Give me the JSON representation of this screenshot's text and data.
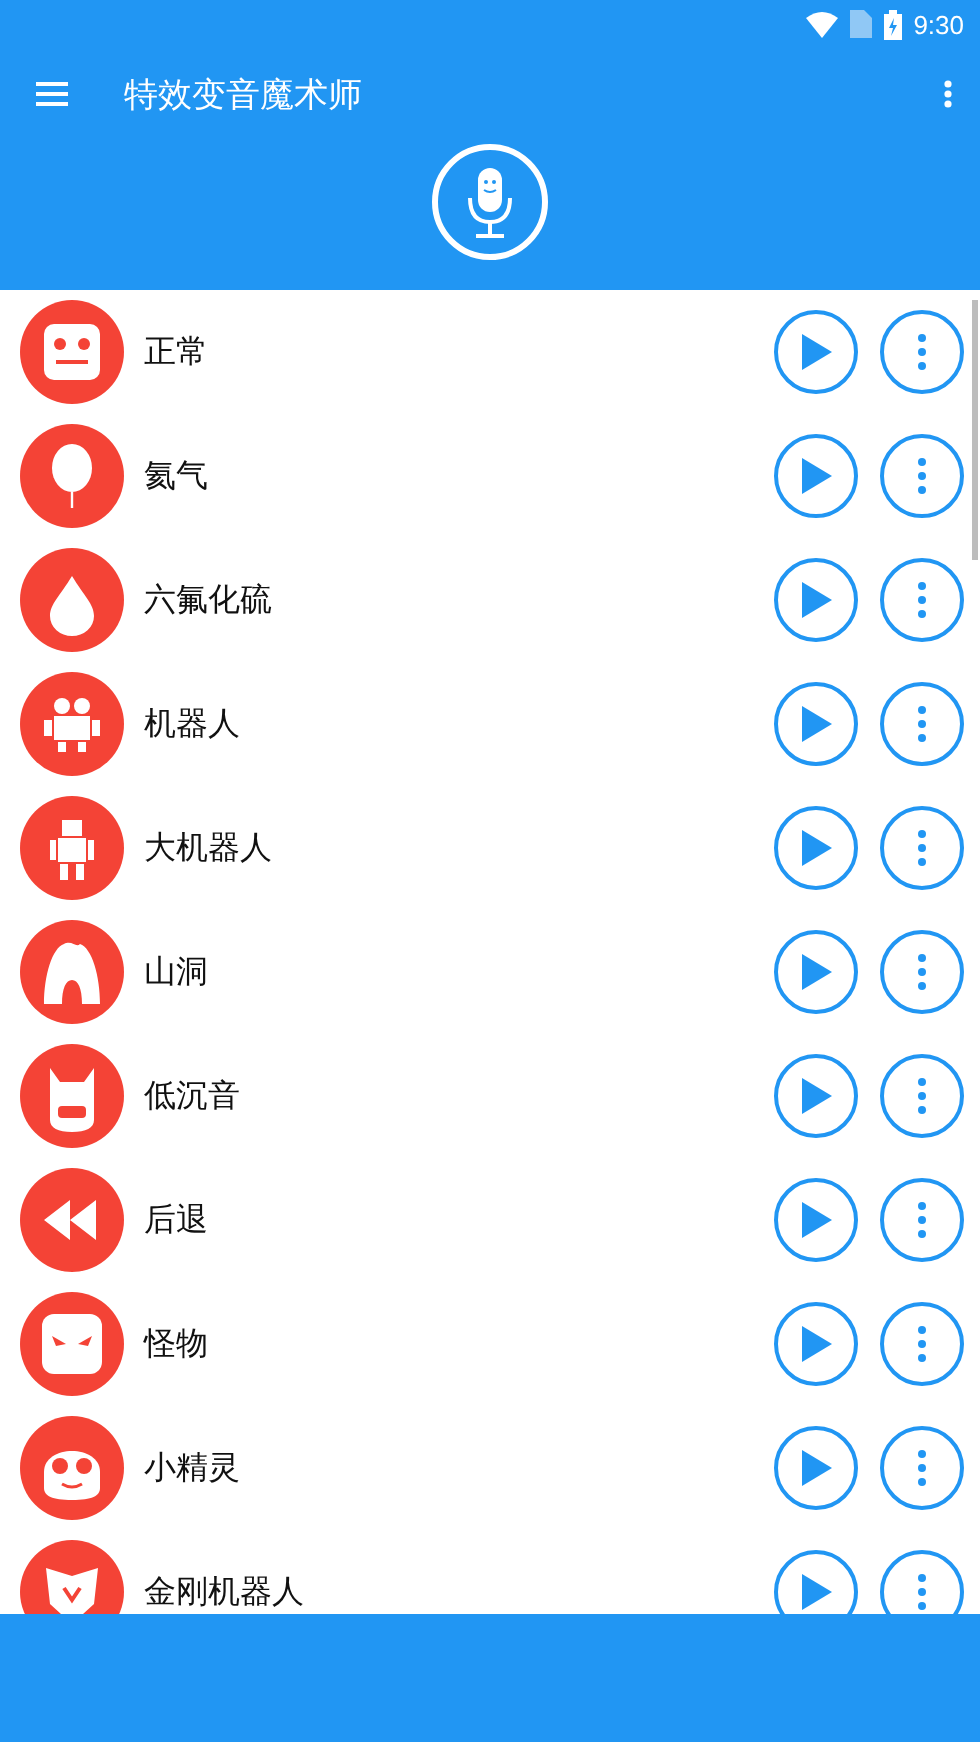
{
  "status_bar": {
    "time": "9:30"
  },
  "toolbar": {
    "title": "特效变音魔术师"
  },
  "effects": [
    {
      "name": "正常",
      "kind": "face"
    },
    {
      "name": "氦气",
      "kind": "balloon"
    },
    {
      "name": "六氟化硫",
      "kind": "drop"
    },
    {
      "name": "机器人",
      "kind": "robot"
    },
    {
      "name": "大机器人",
      "kind": "tallrobot"
    },
    {
      "name": "山洞",
      "kind": "cave"
    },
    {
      "name": "低沉音",
      "kind": "mask"
    },
    {
      "name": "后退",
      "kind": "rewind"
    },
    {
      "name": "怪物",
      "kind": "monster"
    },
    {
      "name": "小精灵",
      "kind": "goggles"
    },
    {
      "name": "金刚机器人",
      "kind": "emblem"
    }
  ]
}
